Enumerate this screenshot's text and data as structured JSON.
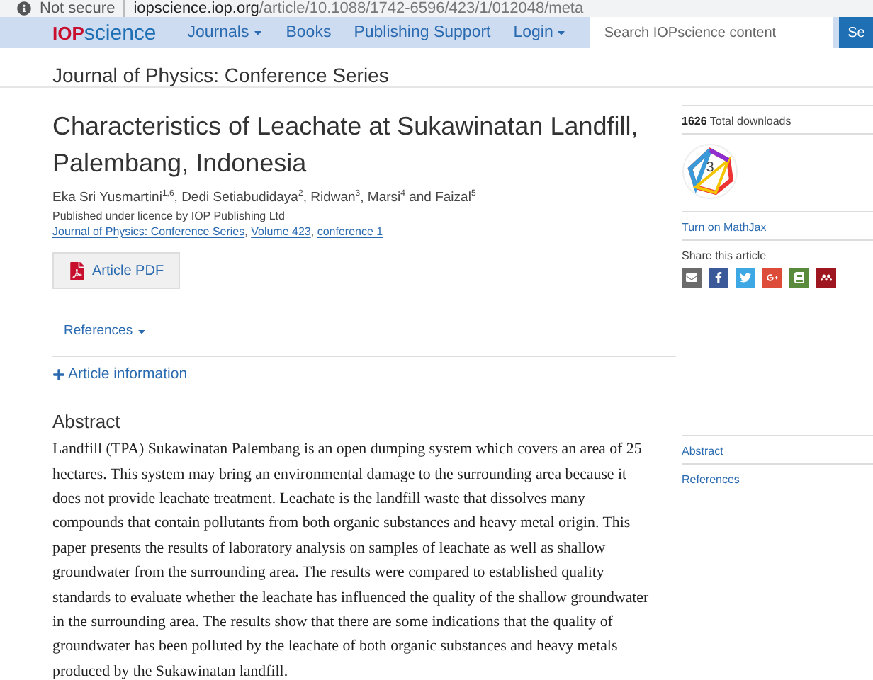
{
  "address_bar": {
    "security": "Not secure",
    "domain": "iopscience.iop.org",
    "path": "/article/10.1088/1742-6596/423/1/012048/meta"
  },
  "nav": {
    "logo_bold": "IOP",
    "logo_rest": "science",
    "items": [
      {
        "label": "Journals",
        "dropdown": true
      },
      {
        "label": "Books",
        "dropdown": false
      },
      {
        "label": "Publishing Support",
        "dropdown": false
      },
      {
        "label": "Login",
        "dropdown": true
      }
    ],
    "search": {
      "placeholder": "Search IOPscience content",
      "button": "Se"
    }
  },
  "journal_title": "Journal of Physics: Conference Series",
  "article": {
    "title": "Characteristics of Leachate at Sukawinatan Landfill, Palembang, Indonesia",
    "authors": "Eka Sri Yusmartini$^{1,6}$, Dedi Setiabudidaya$^{2}$, Ridwan$^{3}$, Marsi$^{4}$ and Faizal$^{5}$",
    "licence": "Published under licence by IOP Publishing Ltd",
    "links": [
      "Journal of Physics: Conference Series",
      "Volume 423",
      "conference 1"
    ],
    "link_separator": ",",
    "pdf_button": "Article PDF",
    "references_toggle": "References",
    "article_info": "Article information",
    "abstract_heading": "Abstract",
    "abstract": "Landfill (TPA) Sukawinatan Palembang is an open dumping system which covers an area of 25 hectares. This system may bring an environmental damage to the surrounding area because it does not provide leachate treatment. Leachate is the landfill waste that dissolves many compounds that contain pollutants from both organic substances and heavy metal origin. This paper presents the results of laboratory analysis on samples of leachate as well as shallow groundwater from the surrounding area. The results were compared to established quality standards to evaluate whether the leachate has influenced the quality of the shallow groundwater in the surrounding area. The results show that there are some indications that the quality of groundwater has been polluted by the leachate of both organic substances and heavy metals produced by the Sukawinatan landfill."
  },
  "sidebar": {
    "downloads_count": "1626",
    "downloads_label": "Total downloads",
    "altmetric_score": "3",
    "mathjax": "Turn on MathJax",
    "share_label": "Share this article",
    "share": [
      {
        "kind": "email"
      },
      {
        "kind": "facebook"
      },
      {
        "kind": "twitter"
      },
      {
        "kind": "googleplus"
      },
      {
        "kind": "book"
      },
      {
        "kind": "mendeley"
      }
    ],
    "toc": [
      "Abstract",
      "References"
    ]
  }
}
